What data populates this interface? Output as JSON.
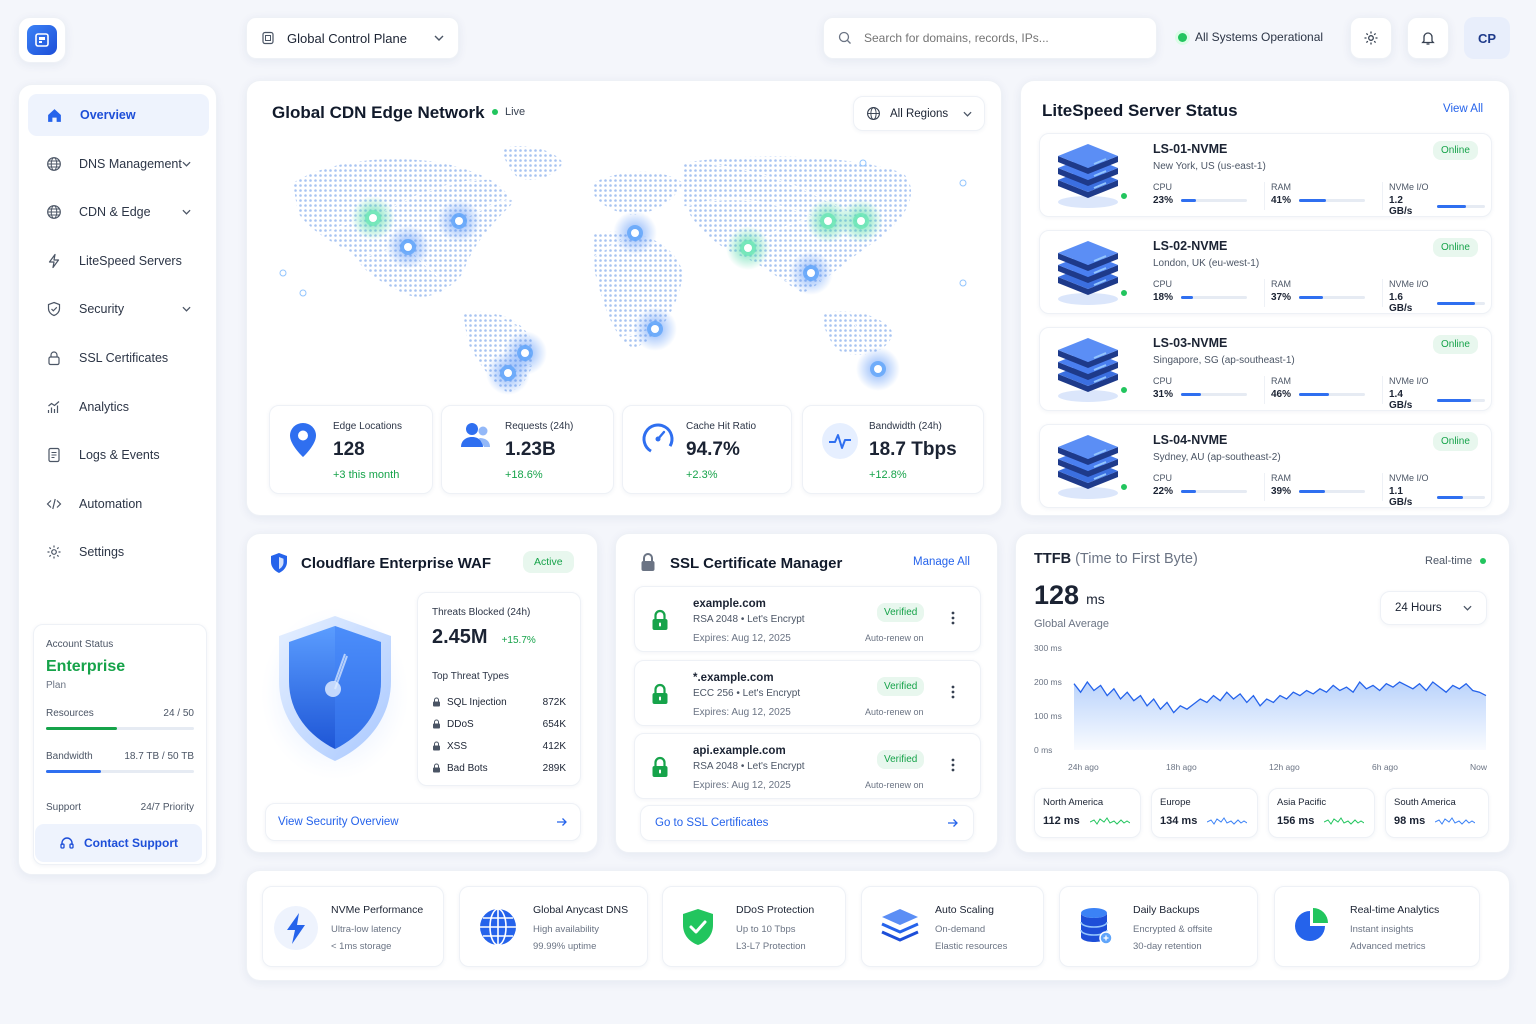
{
  "header": {
    "plane_selector": "Global Control Plane",
    "search_placeholder": "Search for domains, records, IPs...",
    "status": "All Systems Operational",
    "avatar": "CP"
  },
  "sidebar": {
    "items": [
      {
        "label": "Overview",
        "icon": "home-icon",
        "active": true,
        "expand": false
      },
      {
        "label": "DNS Management",
        "icon": "globe-icon",
        "expand": true
      },
      {
        "label": "CDN & Edge",
        "icon": "globe-icon",
        "expand": true
      },
      {
        "label": "LiteSpeed Servers",
        "icon": "bolt-icon",
        "expand": false
      },
      {
        "label": "Security",
        "icon": "shield-icon",
        "expand": true
      },
      {
        "label": "SSL Certificates",
        "icon": "lock-icon",
        "expand": false
      },
      {
        "label": "Analytics",
        "icon": "chart-icon",
        "expand": false
      },
      {
        "label": "Logs & Events",
        "icon": "document-icon",
        "expand": false
      },
      {
        "label": "Automation",
        "icon": "code-icon",
        "expand": false
      },
      {
        "label": "Settings",
        "icon": "gear-icon",
        "expand": false
      }
    ],
    "account": {
      "label": "Account Status",
      "plan": "Enterprise",
      "plan_sub": "Plan",
      "resources_label": "Resources",
      "resources_value": "24 / 50",
      "resources_frac": 0.48,
      "bandwidth_label": "Bandwidth",
      "bandwidth_value": "18.7 TB / 50 TB",
      "bandwidth_frac": 0.37,
      "support_label": "Support",
      "support_value": "24/7 Priority",
      "contact": "Contact Support"
    }
  },
  "cdn": {
    "title": "Global CDN Edge Network",
    "live": "Live",
    "region": "All Regions",
    "stats": [
      {
        "label": "Edge Locations",
        "value": "128",
        "delta": "+3 this month",
        "icon": "location-pin-icon"
      },
      {
        "label": "Requests (24h)",
        "value": "1.23B",
        "delta": "+18.6%",
        "icon": "users-icon"
      },
      {
        "label": "Cache Hit Ratio",
        "value": "94.7%",
        "delta": "+2.3%",
        "icon": "gauge-icon"
      },
      {
        "label": "Bandwidth (24h)",
        "value": "18.7 Tbps",
        "delta": "+12.8%",
        "icon": "pulse-icon"
      }
    ]
  },
  "servers": {
    "title": "LiteSpeed Server Status",
    "view_all": "View All",
    "items": [
      {
        "name": "LS-01-NVME",
        "location": "New York, US (us-east-1)",
        "status": "Online",
        "cpu": "23%",
        "cpu_frac": 0.23,
        "ram": "41%",
        "ram_frac": 0.41,
        "io": "1.2 GB/s",
        "io_frac": 0.6
      },
      {
        "name": "LS-02-NVME",
        "location": "London, UK (eu-west-1)",
        "status": "Online",
        "cpu": "18%",
        "cpu_frac": 0.18,
        "ram": "37%",
        "ram_frac": 0.37,
        "io": "1.6 GB/s",
        "io_frac": 0.8
      },
      {
        "name": "LS-03-NVME",
        "location": "Singapore, SG (ap-southeast-1)",
        "status": "Online",
        "cpu": "31%",
        "cpu_frac": 0.31,
        "ram": "46%",
        "ram_frac": 0.46,
        "io": "1.4 GB/s",
        "io_frac": 0.7
      },
      {
        "name": "LS-04-NVME",
        "location": "Sydney, AU (ap-southeast-2)",
        "status": "Online",
        "cpu": "22%",
        "cpu_frac": 0.22,
        "ram": "39%",
        "ram_frac": 0.39,
        "io": "1.1 GB/s",
        "io_frac": 0.55
      }
    ],
    "cpu_label": "CPU",
    "ram_label": "RAM",
    "io_label": "NVMe I/O"
  },
  "waf": {
    "title": "Cloudflare Enterprise WAF",
    "status": "Active",
    "blocked_label": "Threats Blocked (24h)",
    "blocked_value": "2.45M",
    "blocked_delta": "+15.7%",
    "types_label": "Top Threat Types",
    "threats": [
      {
        "name": "SQL Injection",
        "value": "872K"
      },
      {
        "name": "DDoS",
        "value": "654K"
      },
      {
        "name": "XSS",
        "value": "412K"
      },
      {
        "name": "Bad Bots",
        "value": "289K"
      }
    ],
    "link": "View Security Overview"
  },
  "ssl": {
    "title": "SSL Certificate Manager",
    "manage": "Manage All",
    "certs": [
      {
        "domain": "example.com",
        "type": "RSA 2048 • Let's Encrypt",
        "expires": "Expires: Aug 12, 2025",
        "status": "Verified",
        "renew": "Auto-renew on"
      },
      {
        "domain": "*.example.com",
        "type": "ECC 256 • Let's Encrypt",
        "expires": "Expires: Aug 12, 2025",
        "status": "Verified",
        "renew": "Auto-renew on"
      },
      {
        "domain": "api.example.com",
        "type": "RSA 2048 • Let's Encrypt",
        "expires": "Expires: Aug 12, 2025",
        "status": "Verified",
        "renew": "Auto-renew on"
      }
    ],
    "link": "Go to SSL Certificates"
  },
  "ttfb": {
    "title": "TTFB",
    "title_sub": "(Time to First Byte)",
    "realtime": "Real-time",
    "value": "128",
    "unit": "ms",
    "caption": "Global Average",
    "range": "24 Hours",
    "regions": [
      {
        "name": "North America",
        "value": "112 ms"
      },
      {
        "name": "Europe",
        "value": "134 ms"
      },
      {
        "name": "Asia Pacific",
        "value": "156 ms"
      },
      {
        "name": "South America",
        "value": "98 ms"
      }
    ]
  },
  "chart_data": {
    "type": "area",
    "x": [
      "24h ago",
      "18h ago",
      "12h ago",
      "6h ago",
      "Now"
    ],
    "ylabels": [
      "300 ms",
      "200 ms",
      "100 ms",
      "0 ms"
    ],
    "ylim": [
      0,
      300
    ],
    "values": [
      195,
      170,
      200,
      175,
      190,
      160,
      180,
      150,
      170,
      145,
      160,
      130,
      150,
      120,
      140,
      110,
      130,
      120,
      135,
      150,
      140,
      160,
      145,
      170,
      150,
      165,
      140,
      160,
      130,
      150,
      140,
      160,
      150,
      170,
      160,
      175,
      165,
      180,
      170,
      190,
      175,
      185,
      170,
      200,
      180,
      190,
      175,
      195,
      185,
      200,
      190,
      180,
      195,
      175,
      200,
      185,
      170,
      190,
      180,
      195,
      175,
      170,
      160
    ]
  },
  "features": [
    {
      "title": "NVMe Performance",
      "l1": "Ultra-low latency",
      "l2": "< 1ms storage",
      "icon": "bolt-icon"
    },
    {
      "title": "Global Anycast DNS",
      "l1": "High availability",
      "l2": "99.99% uptime",
      "icon": "globe-icon"
    },
    {
      "title": "DDoS Protection",
      "l1": "Up to 10 Tbps",
      "l2": "L3-L7 Protection",
      "icon": "shield-check-icon"
    },
    {
      "title": "Auto Scaling",
      "l1": "On-demand",
      "l2": "Elastic resources",
      "icon": "layers-icon"
    },
    {
      "title": "Daily Backups",
      "l1": "Encrypted & offsite",
      "l2": "30-day retention",
      "icon": "database-icon"
    },
    {
      "title": "Real-time Analytics",
      "l1": "Instant insights",
      "l2": "Advanced metrics",
      "icon": "pie-chart-icon"
    }
  ]
}
